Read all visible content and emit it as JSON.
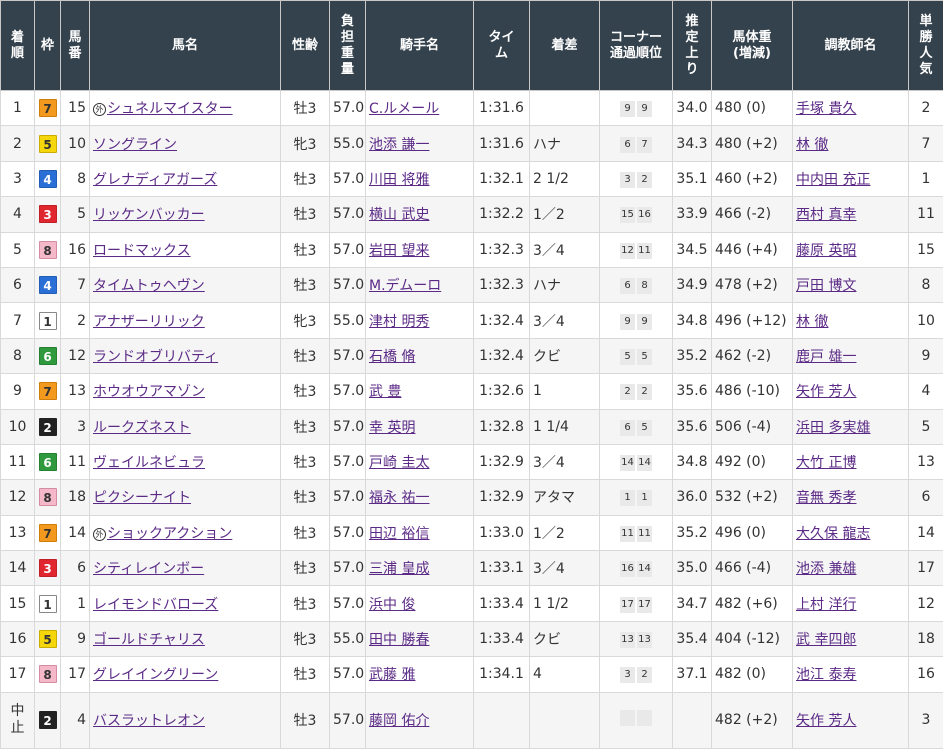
{
  "headers": {
    "chakujun": [
      "着",
      "順"
    ],
    "waku": [
      "枠"
    ],
    "umaban": [
      "馬",
      "番"
    ],
    "bamei": [
      "馬名"
    ],
    "seirei": [
      "性齢"
    ],
    "futan": [
      "負",
      "担",
      "重",
      "量"
    ],
    "kishu": [
      "騎手名"
    ],
    "time": [
      "タイ",
      "ム"
    ],
    "chakusa": [
      "着差"
    ],
    "corner": [
      "コーナー",
      "通過順位"
    ],
    "agari": [
      "推",
      "定",
      "上",
      "り"
    ],
    "bataiju": [
      "馬体重",
      "(増減)"
    ],
    "chokyoshi": [
      "調教師名"
    ],
    "ninki": [
      "単",
      "勝",
      "人",
      "気"
    ]
  },
  "colors": {
    "header_bg": "#34424d",
    "link": "#5b2a86"
  },
  "rows": [
    {
      "pos": "1",
      "waku": "7",
      "umaban": "15",
      "mark": "外",
      "name": "シュネルマイスター",
      "sexage": "牡3",
      "weight": "57.0",
      "jockey": "C.ルメール",
      "time": "1:31.6",
      "margin": "",
      "corner": [
        "9",
        "9"
      ],
      "agari": "34.0",
      "body": "480 (0)",
      "trainer": "手塚 貴久",
      "ninki": "2"
    },
    {
      "pos": "2",
      "waku": "5",
      "umaban": "10",
      "mark": "",
      "name": "ソングライン",
      "sexage": "牝3",
      "weight": "55.0",
      "jockey": "池添 謙一",
      "time": "1:31.6",
      "margin": "ハナ",
      "corner": [
        "6",
        "7"
      ],
      "agari": "34.3",
      "body": "480 (+2)",
      "trainer": "林 徹",
      "ninki": "7"
    },
    {
      "pos": "3",
      "waku": "4",
      "umaban": "8",
      "mark": "",
      "name": "グレナディアガーズ",
      "sexage": "牡3",
      "weight": "57.0",
      "jockey": "川田 将雅",
      "time": "1:32.1",
      "margin": "2 1/2",
      "corner": [
        "3",
        "2"
      ],
      "agari": "35.1",
      "body": "460 (+2)",
      "trainer": "中内田 充正",
      "ninki": "1"
    },
    {
      "pos": "4",
      "waku": "3",
      "umaban": "5",
      "mark": "",
      "name": "リッケンバッカー",
      "sexage": "牡3",
      "weight": "57.0",
      "jockey": "横山 武史",
      "time": "1:32.2",
      "margin": "1／2",
      "corner": [
        "15",
        "16"
      ],
      "agari": "33.9",
      "body": "466 (-2)",
      "trainer": "西村 真幸",
      "ninki": "11"
    },
    {
      "pos": "5",
      "waku": "8",
      "umaban": "16",
      "mark": "",
      "name": "ロードマックス",
      "sexage": "牡3",
      "weight": "57.0",
      "jockey": "岩田 望来",
      "time": "1:32.3",
      "margin": "3／4",
      "corner": [
        "12",
        "11"
      ],
      "agari": "34.5",
      "body": "446 (+4)",
      "trainer": "藤原 英昭",
      "ninki": "15"
    },
    {
      "pos": "6",
      "waku": "4",
      "umaban": "7",
      "mark": "",
      "name": "タイムトゥヘヴン",
      "sexage": "牡3",
      "weight": "57.0",
      "jockey": "M.デムーロ",
      "time": "1:32.3",
      "margin": "ハナ",
      "corner": [
        "6",
        "8"
      ],
      "agari": "34.9",
      "body": "478 (+2)",
      "trainer": "戸田 博文",
      "ninki": "8"
    },
    {
      "pos": "7",
      "waku": "1",
      "umaban": "2",
      "mark": "",
      "name": "アナザーリリック",
      "sexage": "牝3",
      "weight": "55.0",
      "jockey": "津村 明秀",
      "time": "1:32.4",
      "margin": "3／4",
      "corner": [
        "9",
        "9"
      ],
      "agari": "34.8",
      "body": "496 (+12)",
      "trainer": "林 徹",
      "ninki": "10"
    },
    {
      "pos": "8",
      "waku": "6",
      "umaban": "12",
      "mark": "",
      "name": "ランドオブリバティ",
      "sexage": "牡3",
      "weight": "57.0",
      "jockey": "石橋 脩",
      "time": "1:32.4",
      "margin": "クビ",
      "corner": [
        "5",
        "5"
      ],
      "agari": "35.2",
      "body": "462 (-2)",
      "trainer": "鹿戸 雄一",
      "ninki": "9"
    },
    {
      "pos": "9",
      "waku": "7",
      "umaban": "13",
      "mark": "",
      "name": "ホウオウアマゾン",
      "sexage": "牡3",
      "weight": "57.0",
      "jockey": "武 豊",
      "time": "1:32.6",
      "margin": "1",
      "corner": [
        "2",
        "2"
      ],
      "agari": "35.6",
      "body": "486 (-10)",
      "trainer": "矢作 芳人",
      "ninki": "4"
    },
    {
      "pos": "10",
      "waku": "2",
      "umaban": "3",
      "mark": "",
      "name": "ルークズネスト",
      "sexage": "牡3",
      "weight": "57.0",
      "jockey": "幸 英明",
      "time": "1:32.8",
      "margin": "1 1/4",
      "corner": [
        "6",
        "5"
      ],
      "agari": "35.6",
      "body": "506 (-4)",
      "trainer": "浜田 多実雄",
      "ninki": "5"
    },
    {
      "pos": "11",
      "waku": "6",
      "umaban": "11",
      "mark": "",
      "name": "ヴェイルネビュラ",
      "sexage": "牡3",
      "weight": "57.0",
      "jockey": "戸崎 圭太",
      "time": "1:32.9",
      "margin": "3／4",
      "corner": [
        "14",
        "14"
      ],
      "agari": "34.8",
      "body": "492 (0)",
      "trainer": "大竹 正博",
      "ninki": "13"
    },
    {
      "pos": "12",
      "waku": "8",
      "umaban": "18",
      "mark": "",
      "name": "ピクシーナイト",
      "sexage": "牡3",
      "weight": "57.0",
      "jockey": "福永 祐一",
      "time": "1:32.9",
      "margin": "アタマ",
      "corner": [
        "1",
        "1"
      ],
      "agari": "36.0",
      "body": "532 (+2)",
      "trainer": "音無 秀孝",
      "ninki": "6"
    },
    {
      "pos": "13",
      "waku": "7",
      "umaban": "14",
      "mark": "外",
      "name": "ショックアクション",
      "sexage": "牡3",
      "weight": "57.0",
      "jockey": "田辺 裕信",
      "time": "1:33.0",
      "margin": "1／2",
      "corner": [
        "11",
        "11"
      ],
      "agari": "35.2",
      "body": "496 (0)",
      "trainer": "大久保 龍志",
      "ninki": "14"
    },
    {
      "pos": "14",
      "waku": "3",
      "umaban": "6",
      "mark": "",
      "name": "シティレインボー",
      "sexage": "牡3",
      "weight": "57.0",
      "jockey": "三浦 皇成",
      "time": "1:33.1",
      "margin": "3／4",
      "corner": [
        "16",
        "14"
      ],
      "agari": "35.0",
      "body": "466 (-4)",
      "trainer": "池添 兼雄",
      "ninki": "17"
    },
    {
      "pos": "15",
      "waku": "1",
      "umaban": "1",
      "mark": "",
      "name": "レイモンドバローズ",
      "sexage": "牡3",
      "weight": "57.0",
      "jockey": "浜中 俊",
      "time": "1:33.4",
      "margin": "1 1/2",
      "corner": [
        "17",
        "17"
      ],
      "agari": "34.7",
      "body": "482 (+6)",
      "trainer": "上村 洋行",
      "ninki": "12"
    },
    {
      "pos": "16",
      "waku": "5",
      "umaban": "9",
      "mark": "",
      "name": "ゴールドチャリス",
      "sexage": "牝3",
      "weight": "55.0",
      "jockey": "田中 勝春",
      "time": "1:33.4",
      "margin": "クビ",
      "corner": [
        "13",
        "13"
      ],
      "agari": "35.4",
      "body": "404 (-12)",
      "trainer": "武 幸四郎",
      "ninki": "18"
    },
    {
      "pos": "17",
      "waku": "8",
      "umaban": "17",
      "mark": "",
      "name": "グレイイングリーン",
      "sexage": "牡3",
      "weight": "57.0",
      "jockey": "武藤 雅",
      "time": "1:34.1",
      "margin": "4",
      "corner": [
        "3",
        "2"
      ],
      "agari": "37.1",
      "body": "482 (0)",
      "trainer": "池江 泰寿",
      "ninki": "16"
    },
    {
      "pos": "中止",
      "waku": "2",
      "umaban": "4",
      "mark": "",
      "name": "バスラットレオン",
      "sexage": "牡3",
      "weight": "57.0",
      "jockey": "藤岡 佑介",
      "time": "",
      "margin": "",
      "corner": [
        "",
        ""
      ],
      "agari": "",
      "body": "482 (+2)",
      "trainer": "矢作 芳人",
      "ninki": "3"
    }
  ]
}
